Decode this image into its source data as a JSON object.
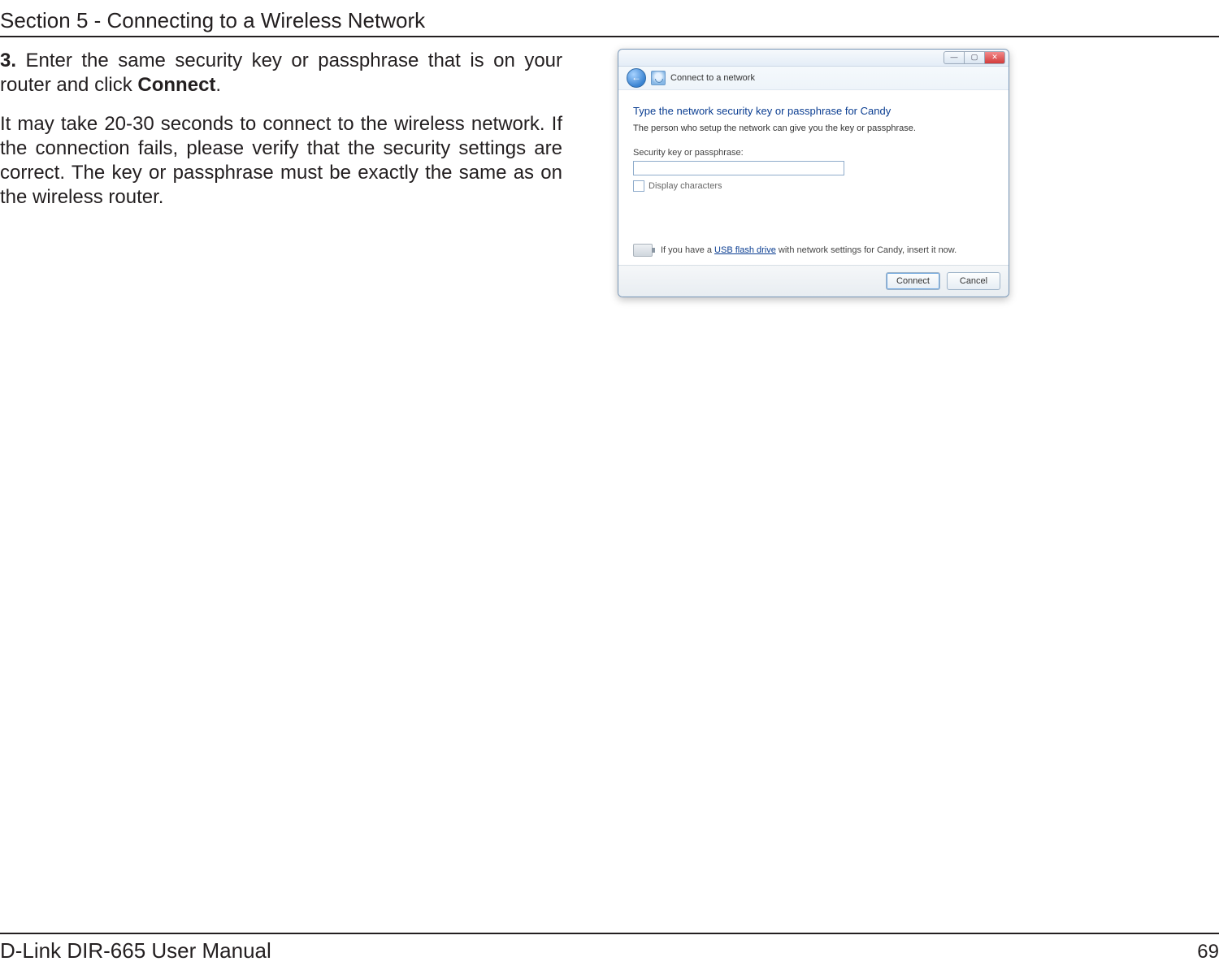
{
  "header": {
    "section": "Section 5 - Connecting to a Wireless Network"
  },
  "step": {
    "num": "3.",
    "text_a": "Enter the same security key or passphrase that is on your router and click ",
    "bold": "Connect",
    "text_b": "."
  },
  "para2": "It may take 20-30 seconds to connect to the wireless network. If the connection fails, please verify that the security settings are correct. The key or passphrase must be exactly the same as on the wireless router.",
  "dialog": {
    "back_glyph": "←",
    "min_glyph": "—",
    "max_glyph": "▢",
    "close_glyph": "✕",
    "nav": "Connect to a network",
    "title": "Type the network security key or passphrase for Candy",
    "subtitle": "The person who setup the network can give you the key or passphrase.",
    "field_label": "Security key or passphrase:",
    "field_value": "",
    "chk_label": "Display characters",
    "usb_a": "If you have a ",
    "usb_link": "USB flash drive",
    "usb_b": " with network settings for Candy, insert it now.",
    "connect": "Connect",
    "cancel": "Cancel"
  },
  "footer": {
    "left": "D-Link DIR-665 User Manual",
    "page": "69"
  }
}
